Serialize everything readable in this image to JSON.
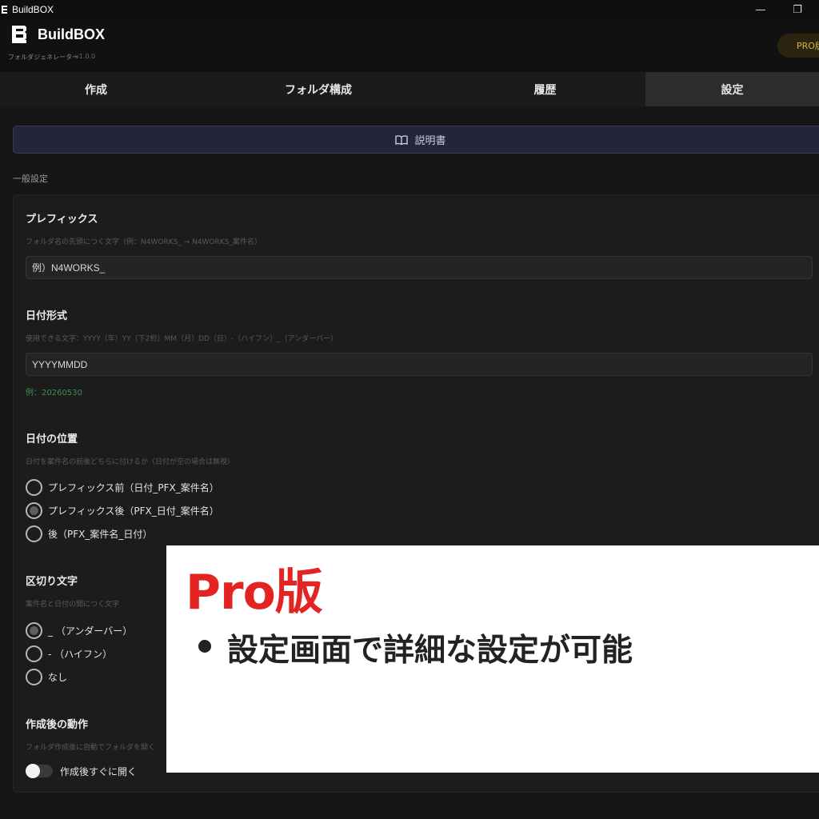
{
  "window": {
    "title": "BuildBOX",
    "minimize_symbol": "—",
    "maximize_symbol": "❐"
  },
  "header": {
    "brand": "BuildBOX",
    "subtitle": "フォルダジェネレーター",
    "version": "v1.0.0",
    "pro_badge": "PRO版"
  },
  "tabs": [
    {
      "label": "作成"
    },
    {
      "label": "フォルダ構成"
    },
    {
      "label": "履歴"
    },
    {
      "label": "設定",
      "active": true
    }
  ],
  "manual_button": {
    "label": "説明書",
    "icon": "book-icon"
  },
  "section": {
    "label": "一般設定"
  },
  "prefix": {
    "title": "プレフィックス",
    "help": "フォルダ名の先頭につく文字（例：N4WORKS_ → N4WORKS_案件名）",
    "placeholder": "例）N4WORKS_"
  },
  "date_format": {
    "title": "日付形式",
    "help": "使用できる文字：YYYY（年）YY（下2桁）MM（月）DD（日）-（ハイフン）_（アンダーバー）",
    "value": "YYYYMMDD",
    "example": "例：20260530"
  },
  "date_position": {
    "title": "日付の位置",
    "help": "日付を案件名の前後どちらに付けるか（日付が空の場合は無視）",
    "options": [
      {
        "label": "プレフィックス前（日付_PFX_案件名）",
        "checked": false
      },
      {
        "label": "プレフィックス後（PFX_日付_案件名）",
        "checked": true
      },
      {
        "label": "後（PFX_案件名_日付）",
        "checked": false
      }
    ]
  },
  "separator": {
    "title": "区切り文字",
    "help": "案件名と日付の間につく文字",
    "options": [
      {
        "label": "_ （アンダーバー）",
        "checked": true
      },
      {
        "label": "- （ハイフン）",
        "checked": false
      },
      {
        "label": "なし",
        "checked": false
      }
    ]
  },
  "after_create": {
    "title": "作成後の動作",
    "help": "フォルダ作成後に自動でフォルダを開く",
    "toggle_label": "作成後すぐに開く",
    "toggle_on": false
  },
  "overlay": {
    "title": "Pro版",
    "bullet": "設定画面で詳細な設定が可能",
    "title_color": "#e42323"
  }
}
